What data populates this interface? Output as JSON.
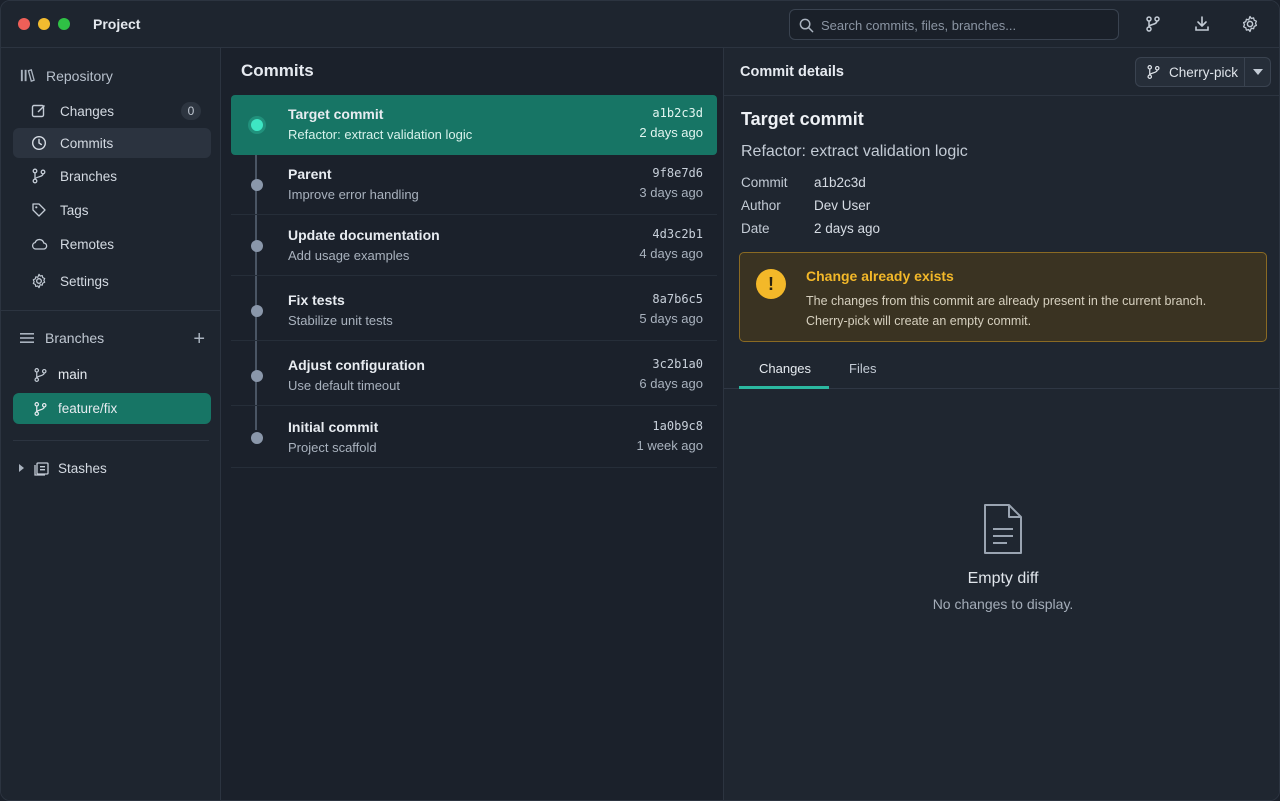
{
  "app": {
    "title": "Project"
  },
  "search": {
    "placeholder": "Search commits, files, branches..."
  },
  "sidebar": {
    "header": "Repository",
    "items": [
      {
        "label": "Changes",
        "badge": "0"
      },
      {
        "label": "Commits"
      },
      {
        "label": "Branches"
      },
      {
        "label": "Tags"
      },
      {
        "label": "Remotes"
      },
      {
        "label": "Settings"
      }
    ],
    "branches_header": "Branches",
    "add_label": "+",
    "branches": [
      {
        "label": "main"
      },
      {
        "label": "feature/fix"
      }
    ],
    "stashes": "Stashes"
  },
  "commits": {
    "title": "Commits",
    "rows": [
      {
        "title": "Target commit",
        "message": "Refactor: extract validation logic",
        "hash": "a1b2c3d",
        "time": "2 days ago"
      },
      {
        "title": "Parent",
        "message": "Improve error handling",
        "hash": "9f8e7d6",
        "time": "3 days ago"
      },
      {
        "title": "Update documentation",
        "message": "Add usage examples",
        "hash": "4d3c2b1",
        "time": "4 days ago"
      },
      {
        "title": "Fix tests",
        "message": "Stabilize unit tests",
        "hash": "8a7b6c5",
        "time": "5 days ago"
      },
      {
        "title": "Adjust configuration",
        "message": "Use default timeout",
        "hash": "3c2b1a0",
        "time": "6 days ago"
      },
      {
        "title": "Initial commit",
        "message": "Project scaffold",
        "hash": "1a0b9c8",
        "time": "1 week ago"
      }
    ]
  },
  "details": {
    "header": "Commit details",
    "cherry_pick": "Cherry-pick",
    "title": "Target commit",
    "subtitle": "Refactor: extract validation logic",
    "meta": [
      {
        "key": "Commit",
        "value": "a1b2c3d"
      },
      {
        "key": "Author",
        "value": "Dev User"
      },
      {
        "key": "Date",
        "value": "2 days ago"
      }
    ],
    "warning": {
      "title": "Change already exists",
      "body": "The changes from this commit are already present in the current branch. Cherry-pick will create an empty commit."
    },
    "tabs": [
      {
        "label": "Changes"
      },
      {
        "label": "Files"
      }
    ],
    "empty": {
      "title": "Empty diff",
      "subtitle": "No changes to display."
    }
  },
  "colors": {
    "accent": "#177565",
    "accent_line": "#2bb8a0",
    "warning": "#f3b829"
  }
}
